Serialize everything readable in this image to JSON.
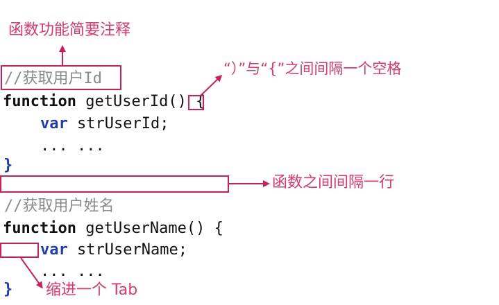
{
  "annotations": {
    "function_comment": "函数功能简要注释",
    "brace_spacing": "“）”与“{”之间间隔一个空格",
    "function_gap": "函数之间间隔一行",
    "indent": "缩进一个 Tab"
  },
  "code": {
    "block1": {
      "comment": "//获取用户Id",
      "keyword": "function",
      "signature": " getUserId() {",
      "var_keyword": "var",
      "var_name": " strUserId;",
      "ellipsis": "... ...",
      "close": "}"
    },
    "block2": {
      "comment": "//获取用户姓名",
      "keyword": "function",
      "signature": " getUserName() {",
      "var_keyword": "var",
      "var_name": " strUserName;",
      "ellipsis": "... ...",
      "close": "}"
    }
  },
  "colors": {
    "annotation": "#e0356c",
    "box": "#d11c59",
    "keyword_blue": "#1e3cb3",
    "comment": "#8a8a8a"
  }
}
